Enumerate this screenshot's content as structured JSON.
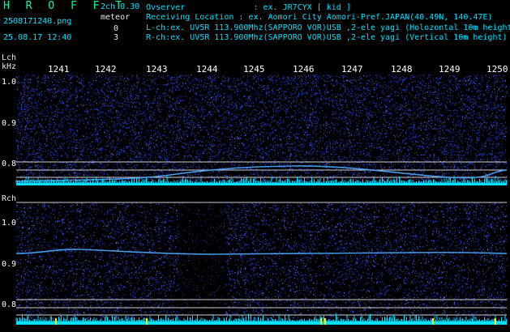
{
  "header": {
    "brand": "H R O F F T",
    "version": "2ch 0.30",
    "filename": "2508171240.png",
    "meteor_label": "meteor",
    "meteor_lch": "0",
    "meteor_rch": "3",
    "datetime": "25.08.17 12:40",
    "observer": "Ovserver              : ex. JR7CYX [ kid ]",
    "location": "Receiving Location : ex. Aomori City Aomori-Pref.JAPAN(40.49N, 140.47E)",
    "lch_info": "L-ch:ex. UV5R 113.900Mhz(SAPPORO VOR)USB ,2-ele yagi (Holozontal 10m height)",
    "rch_info": "R-ch:ex. UV5R 113.900Mhz(SAPPORO VOR)USB ,2-ele yagi (Vertical 10m height)"
  },
  "time_axis": [
    "1241",
    "1242",
    "1243",
    "1244",
    "1245",
    "1246",
    "1247",
    "1248",
    "1249",
    "1250"
  ],
  "lch": {
    "label": "Lch",
    "unit": "kHz",
    "ticks": [
      "1.0",
      "0.9",
      "0.8"
    ]
  },
  "rch": {
    "label": "Rch",
    "ticks": [
      "1.0",
      "0.9",
      "0.8"
    ]
  },
  "colors": {
    "background": "#000000",
    "noise": "#1c3cc8",
    "signal": "#4fa8ff",
    "baseline": "#00e0ff",
    "meteor_marker": "#ffff00",
    "text_cyan": "#00e0ff",
    "brand_green": "#00ffa0"
  }
}
